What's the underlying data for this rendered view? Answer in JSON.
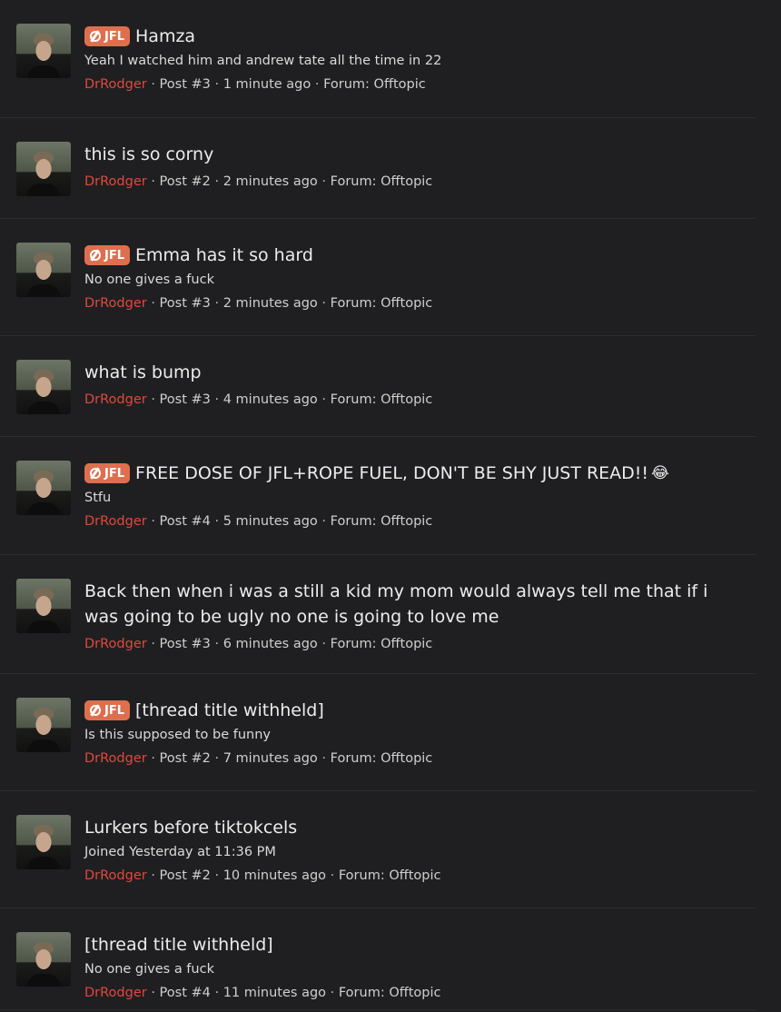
{
  "badge_label": "JFL",
  "posts": [
    {
      "has_badge": true,
      "title": "Hamza",
      "snippet": "Yeah I watched him and andrew tate all the time in 22",
      "author": "DrRodger",
      "post_no": "Post #3",
      "time": "1 minute ago",
      "forum": "Forum: Offtopic"
    },
    {
      "has_badge": false,
      "title": "this is so corny",
      "snippet": "",
      "author": "DrRodger",
      "post_no": "Post #2",
      "time": "2 minutes ago",
      "forum": "Forum: Offtopic"
    },
    {
      "has_badge": true,
      "title": "Emma has it so hard",
      "snippet": "No one gives a fuck",
      "author": "DrRodger",
      "post_no": "Post #3",
      "time": "2 minutes ago",
      "forum": "Forum: Offtopic"
    },
    {
      "has_badge": false,
      "title": "what is bump",
      "snippet": "",
      "author": "DrRodger",
      "post_no": "Post #3",
      "time": "4 minutes ago",
      "forum": "Forum: Offtopic"
    },
    {
      "has_badge": true,
      "title": "FREE DOSE OF JFL+ROPE FUEL, DON'T BE SHY JUST READ!!",
      "emoji": "😂",
      "snippet": "Stfu",
      "author": "DrRodger",
      "post_no": "Post #4",
      "time": "5 minutes ago",
      "forum": "Forum: Offtopic"
    },
    {
      "has_badge": false,
      "title": "Back then when i was a still a kid my mom would always tell me that if i was going to be ugly no one is going to love me",
      "snippet": "",
      "author": "DrRodger",
      "post_no": "Post #3",
      "time": "6 minutes ago",
      "forum": "Forum: Offtopic"
    },
    {
      "has_badge": true,
      "title": "[thread title withheld]",
      "snippet": "Is this supposed to be funny",
      "author": "DrRodger",
      "post_no": "Post #2",
      "time": "7 minutes ago",
      "forum": "Forum: Offtopic"
    },
    {
      "has_badge": false,
      "title": "Lurkers before tiktokcels",
      "snippet": "Joined Yesterday at 11:36 PM",
      "author": "DrRodger",
      "post_no": "Post #2",
      "time": "10 minutes ago",
      "forum": "Forum: Offtopic"
    },
    {
      "has_badge": false,
      "title": "[thread title withheld]",
      "snippet": "No one gives a fuck",
      "author": "DrRodger",
      "post_no": "Post #4",
      "time": "11 minutes ago",
      "forum": "Forum: Offtopic"
    }
  ],
  "separator": "·",
  "colors": {
    "badge": "#de6f4e",
    "author": "#e0483e",
    "background": "#1f1f21"
  }
}
